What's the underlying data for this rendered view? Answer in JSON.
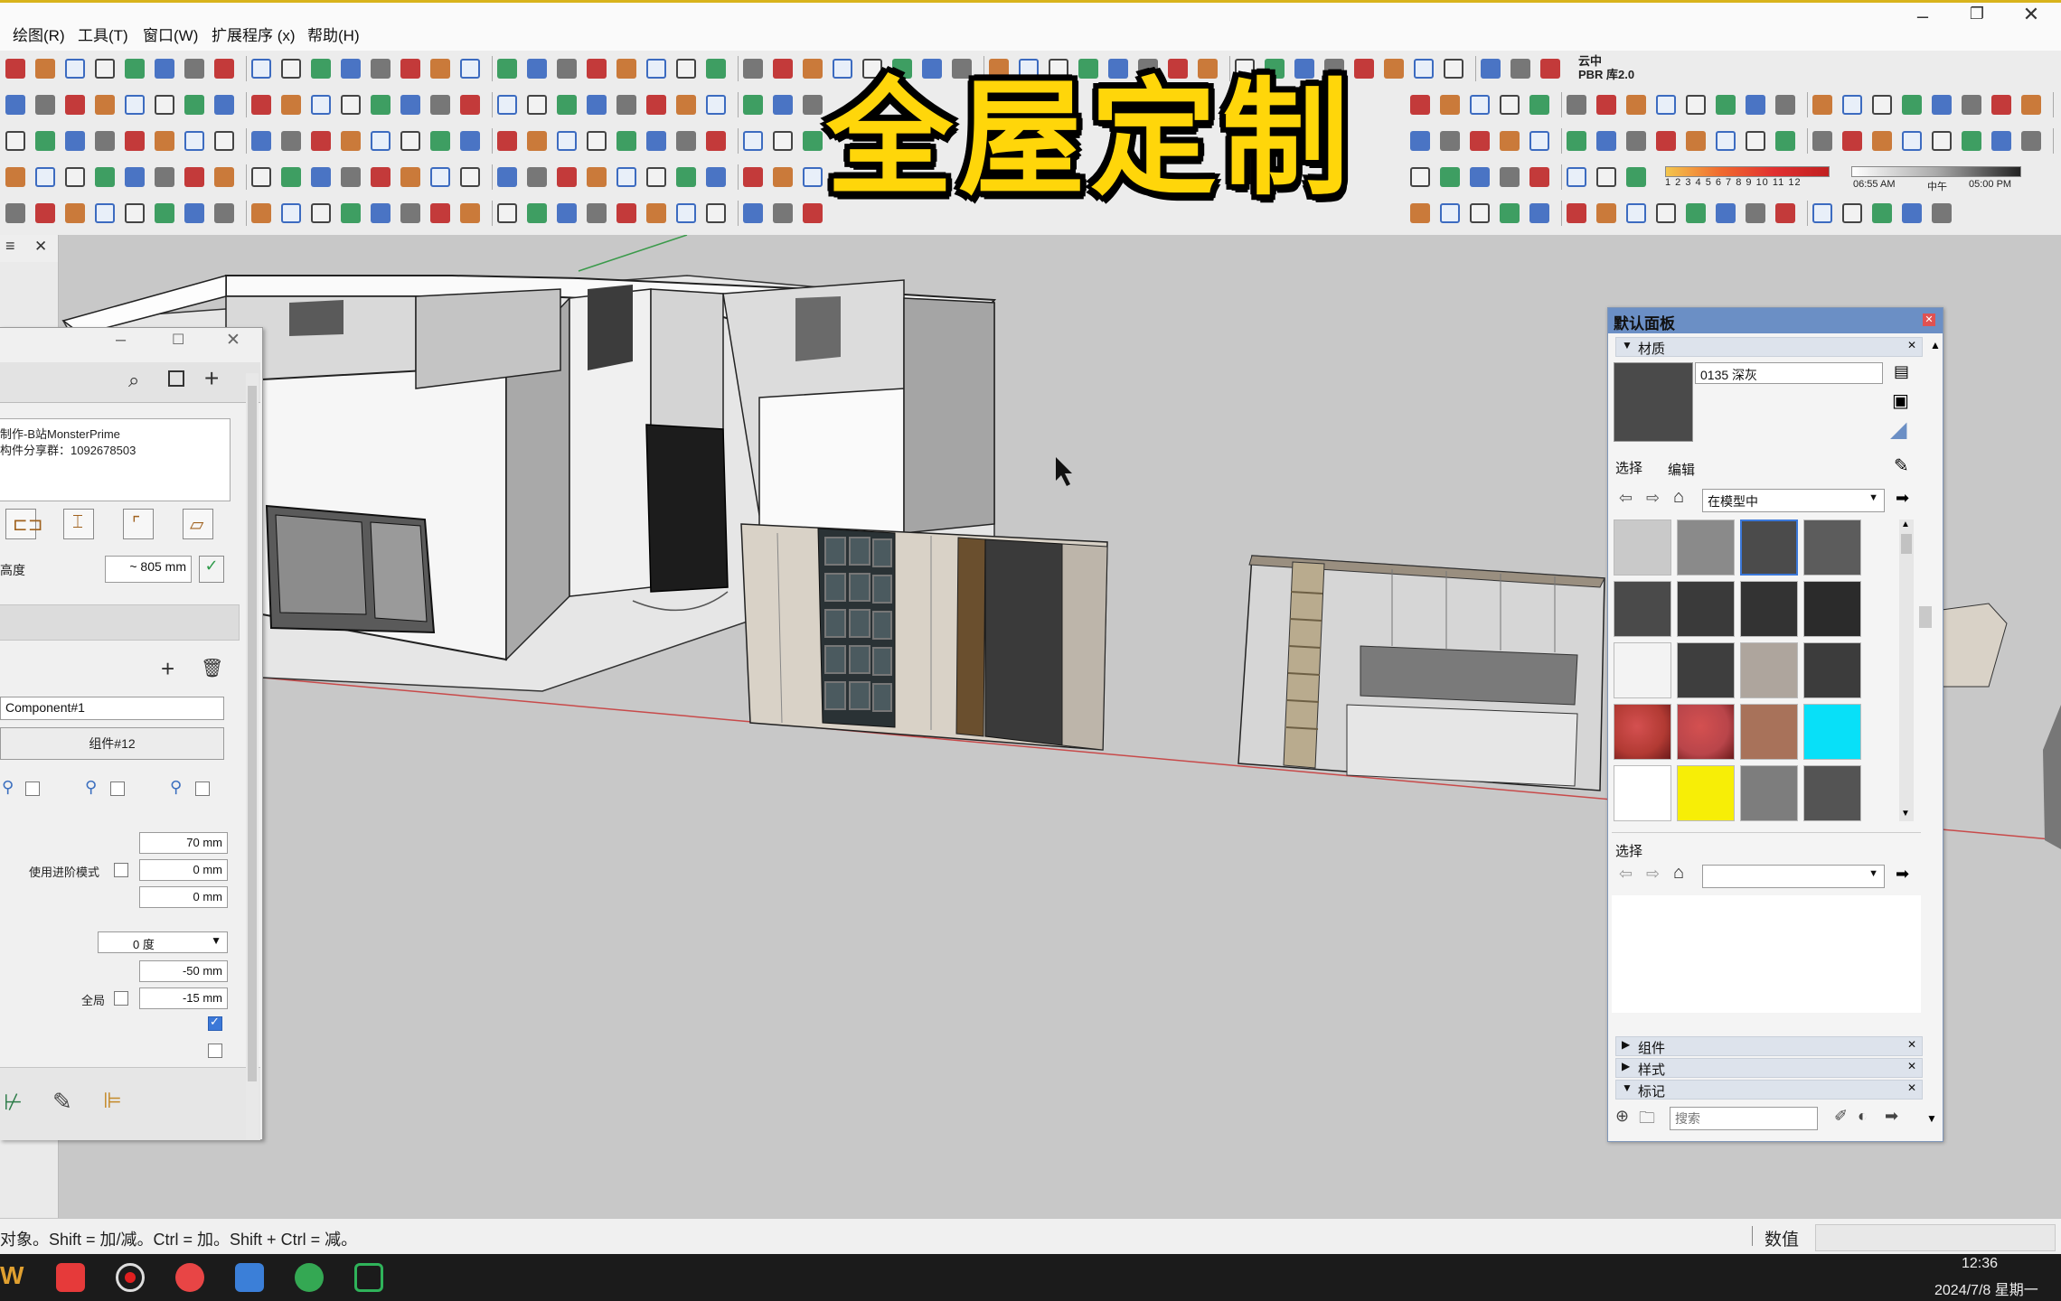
{
  "menu": {
    "items": [
      "绘图(R)",
      "工具(T)",
      "窗口(W)",
      "扩展程序 (x)",
      "帮助(H)"
    ]
  },
  "banner": {
    "text": "全屋定制"
  },
  "toolbar": {
    "cloud_lib_label": "云中\nPBR 库2.0",
    "shadow_scale": "1 2 3 4 5 6 7 8 9 10 11 12",
    "time_start": "06:55 AM",
    "time_mid": "中午",
    "time_end": "05:00 PM"
  },
  "plugin_panel": {
    "desc_line1": "制作-B站MonsterPrime",
    "desc_line2": "构件分享群：1092678503",
    "height_label": "高度",
    "height_value": "~ 805 mm",
    "component_name": "Component#1",
    "group_button": "组件#12",
    "advanced_label": "使用进阶模式",
    "value1": "70 mm",
    "value2": "0 mm",
    "value3": "0 mm",
    "angle_option": "0 度",
    "value4": "-50 mm",
    "global_label": "全局",
    "value5": "-15 mm",
    "checkbox_a_checked": true,
    "checkbox_b_checked": false
  },
  "tray": {
    "title": "默认面板",
    "materials": {
      "header": "材质",
      "current_name": "0135 深灰",
      "tab_select": "选择",
      "tab_edit": "编辑",
      "collection": "在模型中",
      "swatch_colors": [
        "#c9c9c9",
        "#8a8a8a",
        "#4b4b4b",
        "#5c5c5c",
        "#4a4a4a",
        "#3a3a3a",
        "#333333",
        "#2b2b2b",
        "#f3f3f3",
        "#3e3e3e",
        "#aea59d",
        "#3c3c3c",
        "#b23a33",
        "#b9454a",
        "#a8725a",
        "#08e0f8",
        "#ffffff",
        "#f7ee06",
        "#7d7d7d",
        "#545454"
      ],
      "selected_index": 2,
      "current_color": "#4a4a4a"
    },
    "select_section": {
      "label": "选择"
    },
    "collapsed_sections": [
      "组件",
      "样式"
    ],
    "tags": {
      "header": "标记",
      "search_placeholder": "搜索"
    }
  },
  "status": {
    "hint": "对象。Shift = 加/减。Ctrl = 加。Shift + Ctrl = 减。",
    "value_label": "数值"
  },
  "taskbar": {
    "time": "12:36",
    "date": "2024/7/8 星期一"
  },
  "colors": {
    "banner_fill": "#ffd60a",
    "tray_title": "#6b8fc5",
    "accent_blue": "#3b78d8"
  }
}
